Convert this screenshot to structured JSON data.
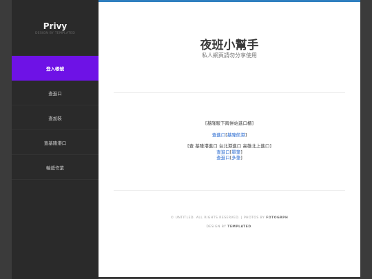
{
  "sidebar": {
    "title": "Privy",
    "subtitle": "DESIGN BY TEMPLATED",
    "nav": [
      "登入帳號",
      "查進口",
      "查加裝",
      "查基隆港口",
      "輸遞作業"
    ]
  },
  "main": {
    "title": "夜班小幫手",
    "subtitle": "私人網頁請勿分享使用",
    "line1": "[基隆駁下兩併站進口櫃]",
    "link1a": "查進口",
    "link1b": "基隆航港",
    "line3": "[查 基隆港進口 台北港進口 高雄北上進口]",
    "link3a": "查進口",
    "link3b": "單筆",
    "link4a": "查進口",
    "link4b": "多筆",
    "footer1_pre": "© UNTITLED. ALL RIGHTS RESERVED. | PHOTOS BY ",
    "footer1_strong": "FOTOGRPH",
    "footer2_pre": "DESIGN BY ",
    "footer2_strong": "TEMPLATED",
    "footer2_post": "."
  },
  "colors": {
    "accent": "#6e12e6",
    "top_bar": "#2f7fc0"
  }
}
